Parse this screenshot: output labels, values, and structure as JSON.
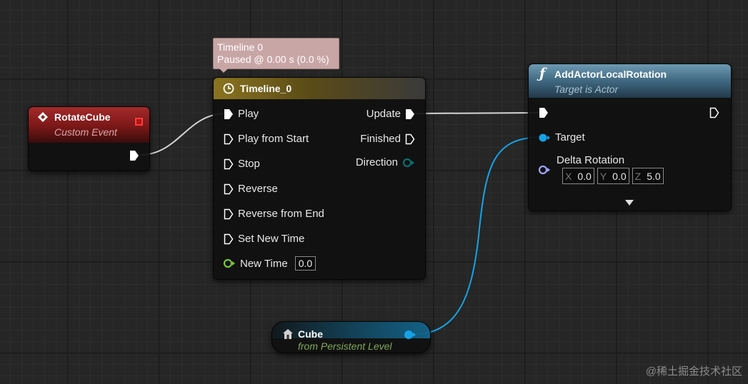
{
  "tooltip": {
    "line1": "Timeline 0",
    "line2": "Paused @ 0.00 s (0.0 %)"
  },
  "rotate_cube": {
    "title": "RotateCube",
    "subtitle": "Custom Event"
  },
  "timeline": {
    "title": "Timeline_0",
    "inputs": [
      "Play",
      "Play from Start",
      "Stop",
      "Reverse",
      "Reverse from End",
      "Set New Time"
    ],
    "new_time_label": "New Time",
    "new_time_value": "0.0",
    "outputs": {
      "update": "Update",
      "finished": "Finished",
      "direction": "Direction"
    }
  },
  "add_rotation": {
    "title": "AddActorLocalRotation",
    "subtitle": "Target is Actor",
    "target_label": "Target",
    "delta_label": "Delta Rotation",
    "x": "0.0",
    "y": "0.0",
    "z": "5.0",
    "x_axis": "X",
    "y_axis": "Y",
    "z_axis": "Z"
  },
  "cube": {
    "title": "Cube",
    "subtitle": "from Persistent Level"
  },
  "watermark": "@稀土掘金技术社区",
  "icons": [
    "event-diamond-icon",
    "clock-icon",
    "function-icon",
    "actor-icon",
    "expand-arrow-icon"
  ],
  "colors": {
    "event_header": "#8d1d1d",
    "timeline_header": "#6c5a16",
    "function_header": "#3d6377",
    "object_pin": "#16a3e6",
    "float_pin": "#7ac341",
    "rotator_pin": "#a0a4ff",
    "direction_pin": "#0b6f6f"
  }
}
